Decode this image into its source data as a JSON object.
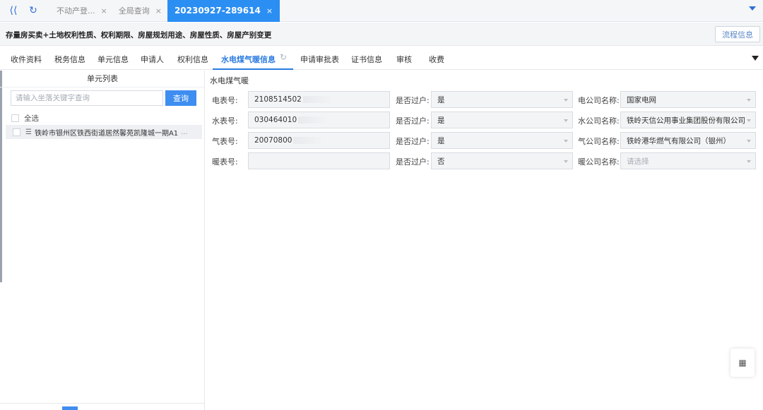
{
  "topbar": {
    "tabs": [
      {
        "label": "不动产登...",
        "close": "×"
      },
      {
        "label": "全局查询",
        "close": "×"
      },
      {
        "label": "20230927-289614",
        "close": "×"
      }
    ]
  },
  "header": {
    "title": "存量房买卖+土地权利性质、权利期限、房屋规划用途、房屋性质、房屋产别变更",
    "flow_button": "流程信息"
  },
  "tabs": [
    {
      "label": "收件资料"
    },
    {
      "label": "税务信息"
    },
    {
      "label": "单元信息"
    },
    {
      "label": "申请人"
    },
    {
      "label": "权利信息"
    },
    {
      "label": "水电煤气暖信息"
    },
    {
      "label": "申请审批表"
    },
    {
      "label": "证书信息"
    },
    {
      "label": "审核"
    },
    {
      "label": "收费"
    }
  ],
  "left_panel": {
    "title": "单元列表",
    "search_placeholder": "请输入坐落关键字查询",
    "search_button": "查询",
    "select_all": "全选",
    "unit_item": "铁岭市银州区铁西街道居然馨苑凯隆城一期A1",
    "unit_item_suffix": "..."
  },
  "content": {
    "section_title": "水电煤气暖",
    "rows": [
      {
        "meter_label": "电表号:",
        "meter_value": "2108514502",
        "transfer_label": "是否过户:",
        "transfer_value": "是",
        "company_label": "电公司名称:",
        "company_value": "国家电网"
      },
      {
        "meter_label": "水表号:",
        "meter_value": "030464010",
        "transfer_label": "是否过户:",
        "transfer_value": "是",
        "company_label": "水公司名称:",
        "company_value": "铁岭天信公用事业集团股份有限公司"
      },
      {
        "meter_label": "气表号:",
        "meter_value": "20070800",
        "transfer_label": "是否过户:",
        "transfer_value": "是",
        "company_label": "气公司名称:",
        "company_value": "铁岭港华燃气有限公司（银州）"
      },
      {
        "meter_label": "暖表号:",
        "meter_value": "",
        "transfer_label": "是否过户:",
        "transfer_value": "否",
        "company_label": "暖公司名称:",
        "company_value": "请选择"
      }
    ]
  },
  "colors": {
    "accent": "#2b8ef3",
    "tab_active": "#2b7be0"
  }
}
